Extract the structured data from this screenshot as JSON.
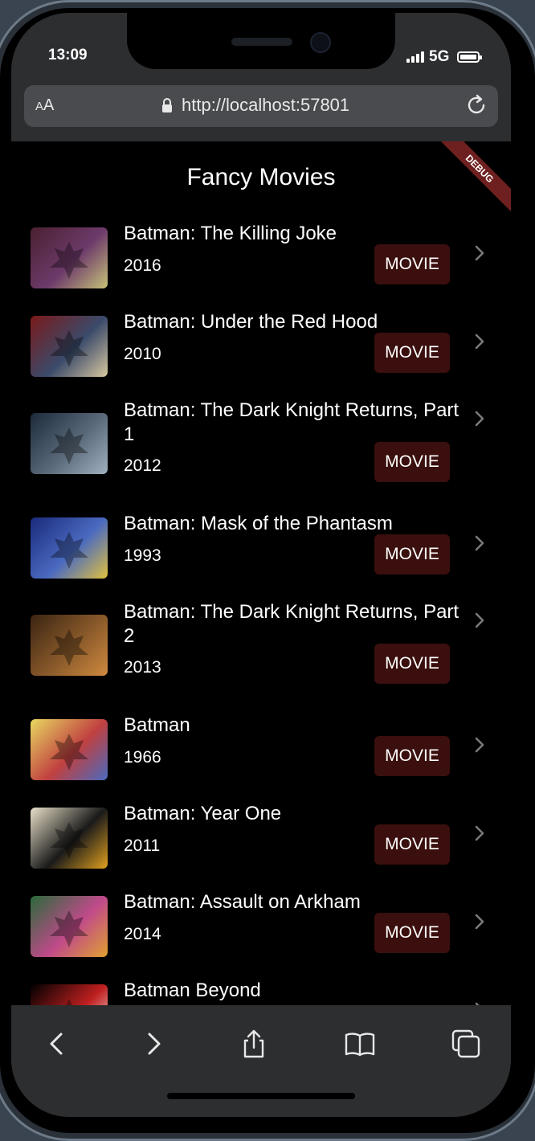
{
  "status_bar": {
    "time": "13:09",
    "network": "5G"
  },
  "browser": {
    "text_size_label_small": "A",
    "text_size_label_large": "A",
    "url": "http://localhost:57801"
  },
  "app": {
    "debug_label": "DEBUG",
    "title": "Fancy Movies",
    "movies": [
      {
        "title": "Batman: The Killing Joke",
        "year": "2016",
        "type": "MOVIE",
        "poster_colors": [
          "#4a2030",
          "#6d3a6a",
          "#c7c37a"
        ]
      },
      {
        "title": "Batman: Under the Red Hood",
        "year": "2010",
        "type": "MOVIE",
        "poster_colors": [
          "#7a1a1a",
          "#3a4a6a",
          "#d8c8a0"
        ]
      },
      {
        "title": "Batman: The Dark Knight Returns, Part 1",
        "year": "2012",
        "type": "MOVIE",
        "poster_colors": [
          "#1c2a3a",
          "#5a6a7a",
          "#a0b0c0"
        ]
      },
      {
        "title": "Batman: Mask of the Phantasm",
        "year": "1993",
        "type": "MOVIE",
        "poster_colors": [
          "#1a2a7a",
          "#4a6ac0",
          "#e0c040"
        ]
      },
      {
        "title": "Batman: The Dark Knight Returns, Part 2",
        "year": "2013",
        "type": "MOVIE",
        "poster_colors": [
          "#3a2412",
          "#8a5a2a",
          "#d08a40"
        ]
      },
      {
        "title": "Batman",
        "year": "1966",
        "type": "MOVIE",
        "poster_colors": [
          "#e8d860",
          "#c04040",
          "#4a6ac0"
        ]
      },
      {
        "title": "Batman: Year One",
        "year": "2011",
        "type": "MOVIE",
        "poster_colors": [
          "#e8e0c8",
          "#1a1a1a",
          "#e0a020"
        ]
      },
      {
        "title": "Batman: Assault on Arkham",
        "year": "2014",
        "type": "MOVIE",
        "poster_colors": [
          "#2a6a3a",
          "#c04a8a",
          "#e0a030"
        ]
      },
      {
        "title": "Batman Beyond",
        "year": "",
        "type": "",
        "poster_colors": [
          "#000000",
          "#c02020",
          "#ffffff"
        ]
      }
    ]
  },
  "toolbar": {
    "icons": [
      "back-icon",
      "forward-icon",
      "share-icon",
      "bookmarks-icon",
      "tabs-icon"
    ]
  }
}
